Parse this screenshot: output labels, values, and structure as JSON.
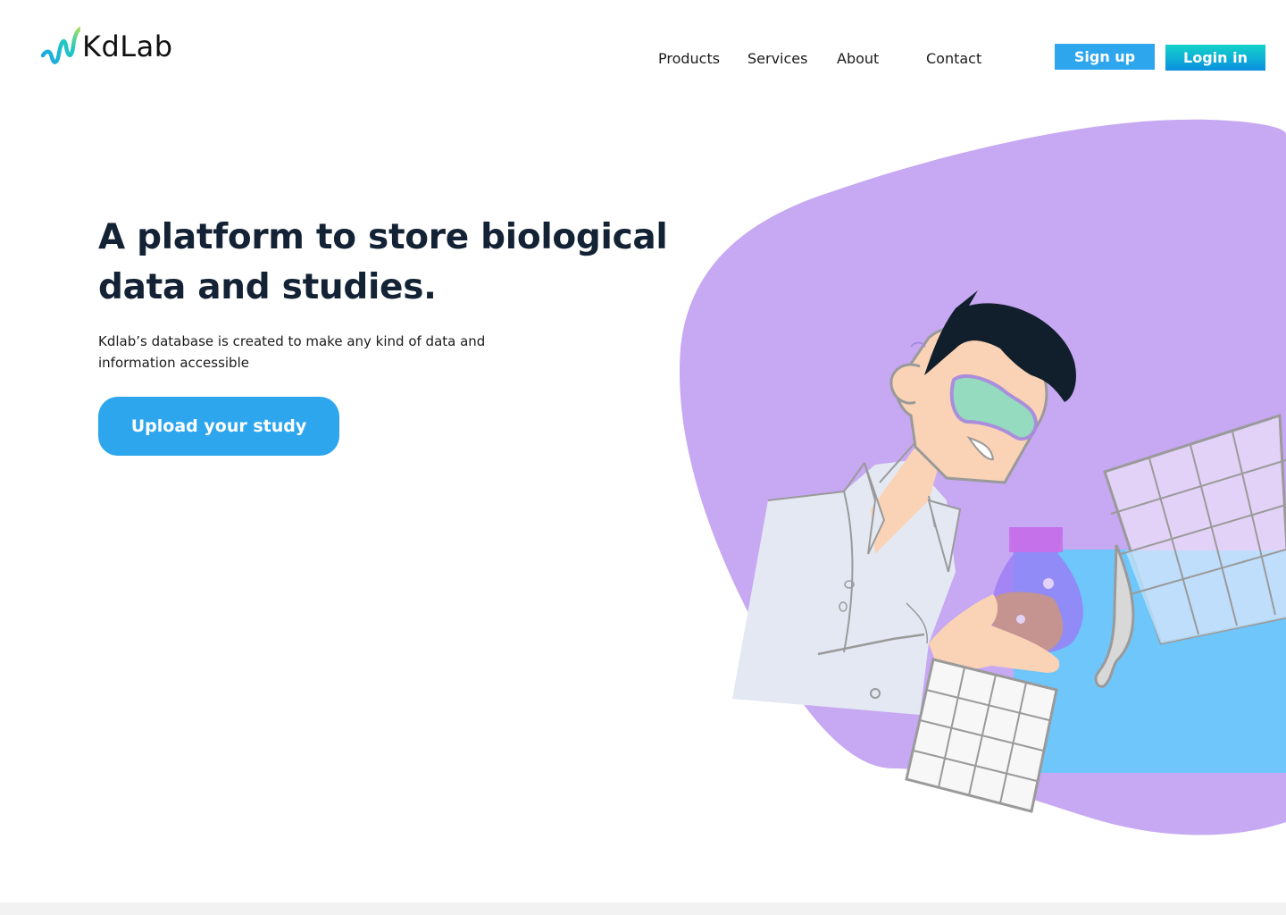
{
  "header": {
    "logo_text": "KdLab",
    "logo_icon": "wave-icon",
    "nav": [
      {
        "label": "Products",
        "name": "nav-products"
      },
      {
        "label": "Services",
        "name": "nav-services"
      },
      {
        "label": "About",
        "name": "nav-about"
      },
      {
        "label": "Contact",
        "name": "nav-contact"
      }
    ],
    "signup_label": "Sign up",
    "login_label": "Login in"
  },
  "hero": {
    "title": "A platform to store biological data and studies.",
    "subtitle": "Kdlab’s database is created to make any kind of data and information accessible",
    "cta_label": "Upload your study"
  },
  "colors": {
    "accent": "#2ea6ee",
    "login_gradient_top": "#14d3c8",
    "login_gradient_bottom": "#0a8fe0",
    "blob": "#c7a8f2",
    "heading": "#132234"
  }
}
